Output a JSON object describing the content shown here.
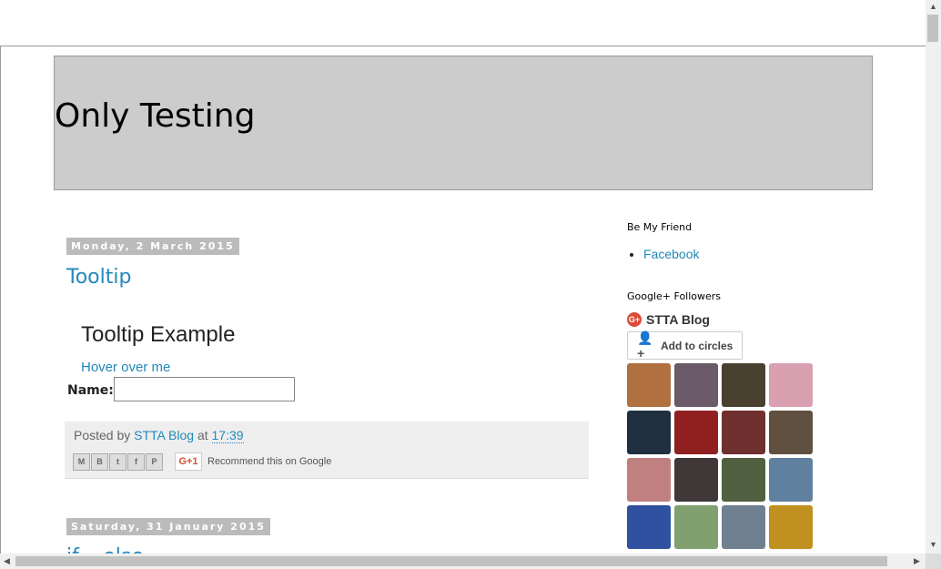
{
  "blog": {
    "title": "Only Testing"
  },
  "posts": [
    {
      "date": "Monday, 2 March 2015",
      "title": "Tooltip",
      "body": {
        "heading": "Tooltip Example",
        "link": "Hover over me",
        "name_label": "Name:",
        "name_value": ""
      },
      "footer": {
        "posted_by_prefix": "Posted by",
        "author": "STTA Blog",
        "at": "at",
        "time": "17:39",
        "recommend": "Recommend this on Google"
      }
    },
    {
      "date": "Saturday, 31 January 2015",
      "title": "if... else ..."
    }
  ],
  "share_buttons": [
    "email",
    "blogger",
    "twitter",
    "facebook",
    "pinterest"
  ],
  "gplus_button": "G+1",
  "sidebar": {
    "friend_title": "Be My Friend",
    "friend_links": [
      "Facebook"
    ],
    "followers_title": "Google+ Followers",
    "gplus_page": "STTA Blog",
    "add_circles": "Add to circles",
    "avatar_colors": [
      "#b07040",
      "#6a5a6a",
      "#4a4030",
      "#d8a0b0",
      "#203040",
      "#902020",
      "#703030",
      "#605040",
      "#c08080",
      "#403838",
      "#506040",
      "#6080a0",
      "#3050a0",
      "#80a070",
      "#708090",
      "#c09020"
    ]
  }
}
